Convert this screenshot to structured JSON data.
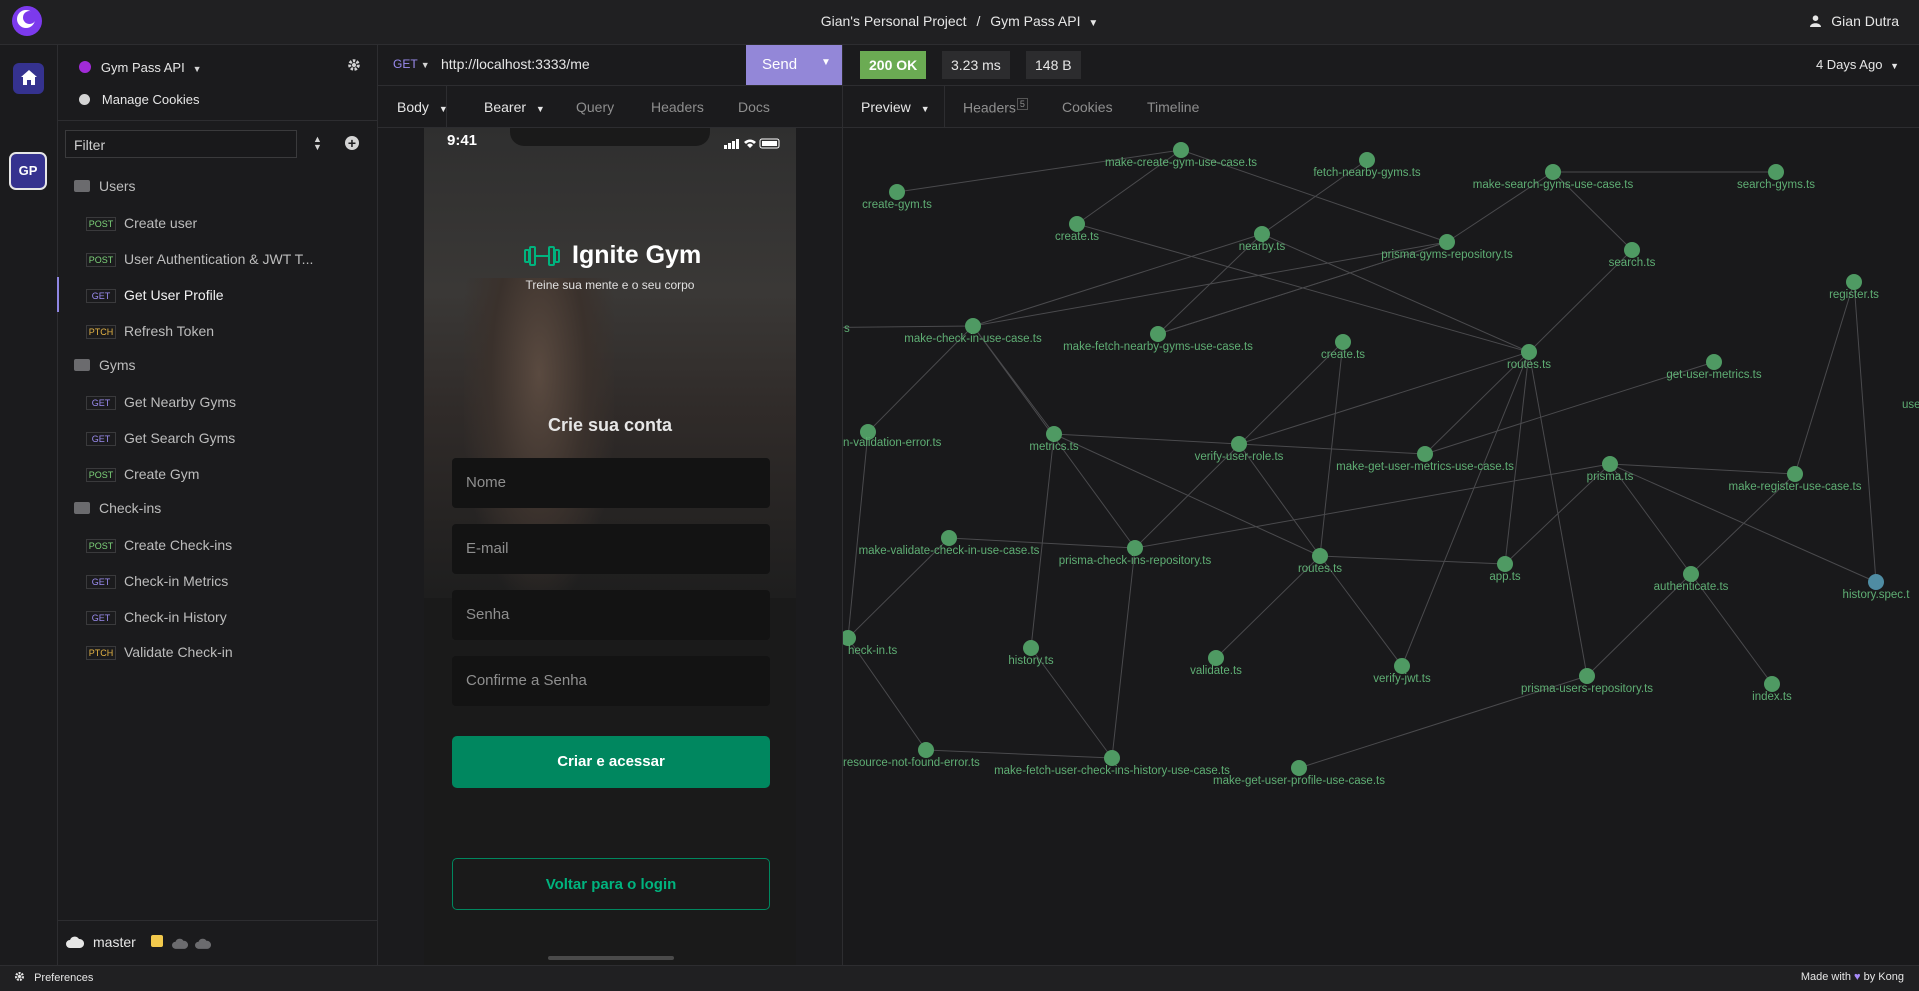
{
  "app": {
    "project": "Gian's Personal Project",
    "separator": "/",
    "collection": "Gym Pass API",
    "user": "Gian Dutra"
  },
  "rail": {
    "home_icon": "home-icon",
    "workspace_initials": "GP"
  },
  "sidebar": {
    "collection_name": "Gym Pass API",
    "manage_cookies": "Manage Cookies",
    "filter_placeholder": "Filter",
    "folders": [
      {
        "name": "Users",
        "requests": [
          {
            "method": "POST",
            "name": "Create user"
          },
          {
            "method": "POST",
            "name": "User Authentication & JWT T..."
          },
          {
            "method": "GET",
            "name": "Get User Profile",
            "active": true
          },
          {
            "method": "PTCH",
            "name": "Refresh Token"
          }
        ]
      },
      {
        "name": "Gyms",
        "requests": [
          {
            "method": "GET",
            "name": "Get Nearby Gyms"
          },
          {
            "method": "GET",
            "name": "Get Search Gyms"
          },
          {
            "method": "POST",
            "name": "Create Gym"
          }
        ]
      },
      {
        "name": "Check-ins",
        "requests": [
          {
            "method": "POST",
            "name": "Create Check-ins"
          },
          {
            "method": "GET",
            "name": "Check-in Metrics"
          },
          {
            "method": "GET",
            "name": "Check-in History"
          },
          {
            "method": "PTCH",
            "name": "Validate Check-in"
          }
        ]
      }
    ],
    "branch": "master"
  },
  "request": {
    "method": "GET",
    "url": "http://localhost:3333/me",
    "send": "Send",
    "tabs": [
      "Body",
      "Bearer",
      "Query",
      "Headers",
      "Docs"
    ]
  },
  "phone": {
    "time": "9:41",
    "brand": "Ignite Gym",
    "tagline": "Treine sua mente e o seu corpo",
    "heading": "Crie sua conta",
    "fields": [
      "Nome",
      "E-mail",
      "Senha",
      "Confirme  a Senha"
    ],
    "primary_button": "Criar e acessar",
    "secondary_button": "Voltar para o login"
  },
  "response": {
    "status": "200 OK",
    "time": "3.23 ms",
    "size": "148 B",
    "age": "4 Days Ago",
    "tabs": [
      "Preview",
      "Headers",
      "Cookies",
      "Timeline"
    ],
    "headers_count": "5"
  },
  "graph": {
    "labels": [
      "make-create-gym-use-case.ts",
      "fetch-nearby-gyms.ts",
      "make-search-gyms-use-case.ts",
      "search-gyms.ts",
      "create-gym.ts",
      "create.ts",
      "nearby.ts",
      "prisma-gyms-repository.ts",
      "search.ts",
      "register.ts",
      "s",
      "make-check-in-use-case.ts",
      "make-fetch-nearby-gyms-use-case.ts",
      "create.ts",
      "routes.ts",
      "get-user-metrics.ts",
      "user-alrea",
      "n-validation-error.ts",
      "metrics.ts",
      "verify-user-role.ts",
      "make-get-user-metrics-use-case.ts",
      "prisma.ts",
      "make-register-use-case.ts",
      "make-validate-check-in-use-case.ts",
      "prisma-check-ins-repository.ts",
      "routes.ts",
      "app.ts",
      "authenticate.ts",
      "history.spec.t",
      "heck-in.ts",
      "history.ts",
      "validate.ts",
      "verify-jwt.ts",
      "prisma-users-repository.ts",
      "index.ts",
      "resource-not-found-error.ts",
      "make-fetch-user-check-ins-history-use-case.ts",
      "make-get-user-profile-use-case.ts"
    ]
  },
  "status_bar": {
    "preferences": "Preferences",
    "made_with_prefix": "Made with",
    "made_with_suffix": "by Kong"
  }
}
